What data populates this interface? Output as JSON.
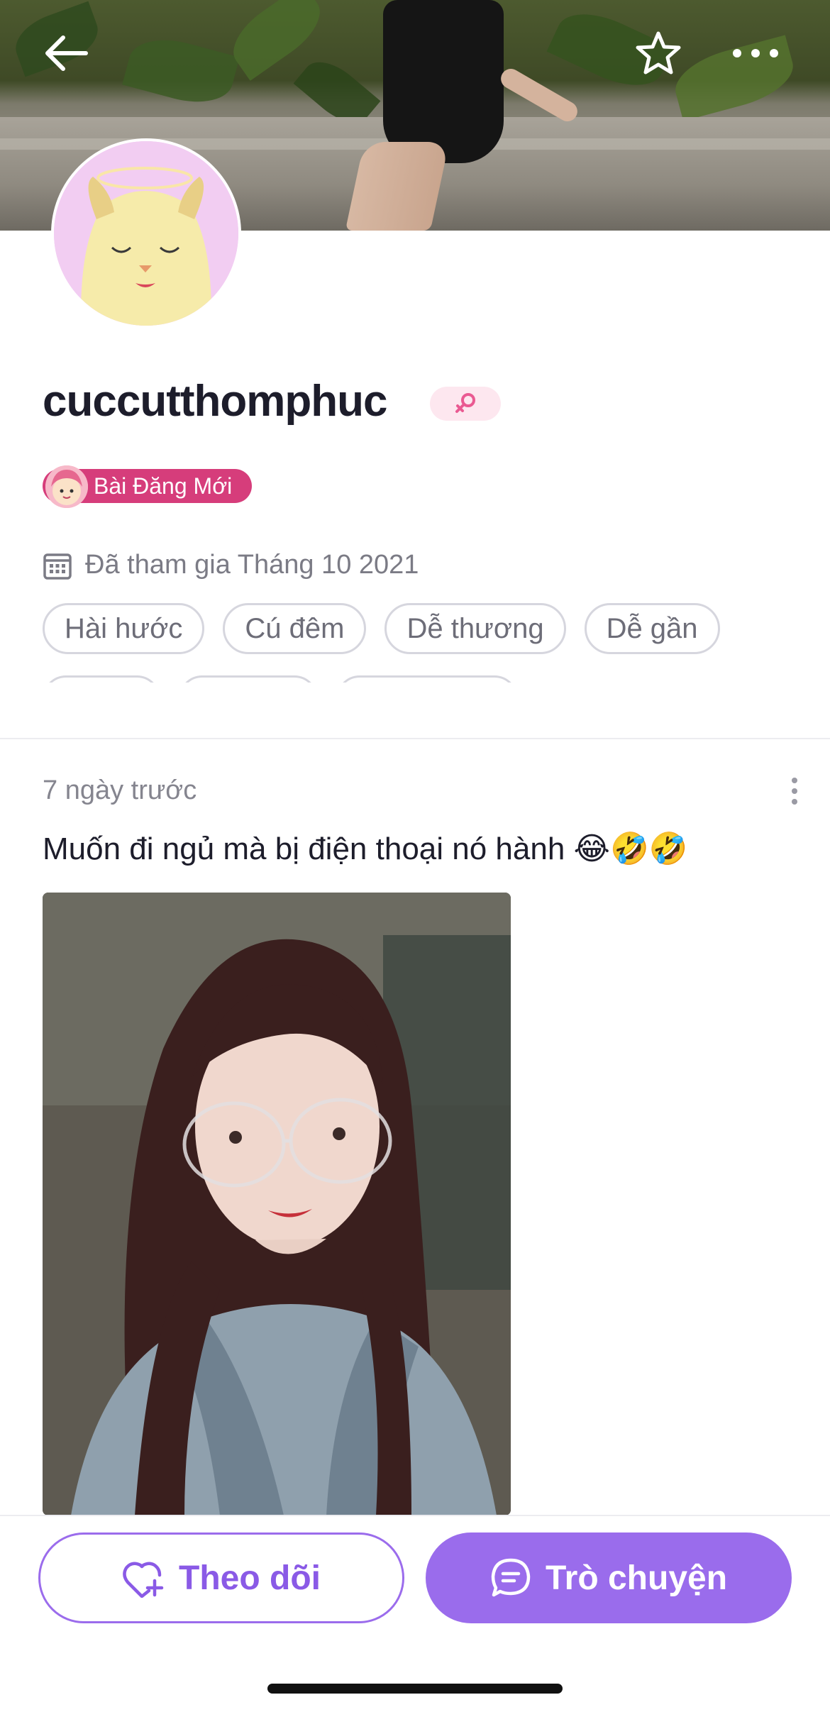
{
  "profile": {
    "username": "cuccutthomphuc",
    "badge_label": "Bài Đăng Mới",
    "joined_text": "Đã tham gia Tháng 10 2021",
    "tags": [
      "Hài hước",
      "Cú đêm",
      "Dễ thương",
      "Dễ gần"
    ]
  },
  "post": {
    "time": "7 ngày trước",
    "text": "Muốn đi ngủ mà bị điện thoại nó hành 😂🤣🤣"
  },
  "actions": {
    "follow_label": "Theo dõi",
    "chat_label": "Trò chuyện"
  },
  "colors": {
    "accent": "#9a6cec",
    "badge": "#d63d7b",
    "gender_pill_bg": "#fde7ef"
  },
  "icons": {
    "back": "arrow-left-icon",
    "star": "star-icon",
    "more": "more-horizontal-icon",
    "calendar": "calendar-icon",
    "follow": "heart-plus-icon",
    "chat": "chat-bubble-icon",
    "gender": "female-icon"
  }
}
